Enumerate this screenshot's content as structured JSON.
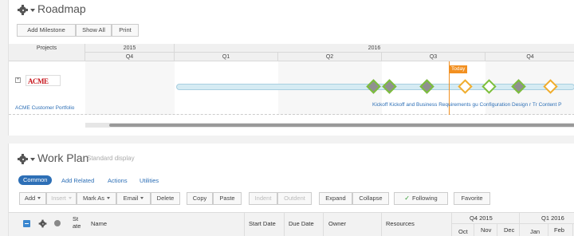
{
  "roadmap": {
    "title": "Roadmap",
    "buttons": {
      "add_milestone": "Add Milestone",
      "show_all": "Show All",
      "print": "Print"
    },
    "projects_header": "Projects",
    "years": [
      "2015",
      "2016"
    ],
    "quarters": [
      "Q4",
      "Q1",
      "Q2",
      "Q3",
      "Q4"
    ],
    "project_name": "ACME Customer Portfolio",
    "logo_text": "ACME",
    "expand_symbol": "+",
    "today_label": "Today",
    "milestone_labels": "Kickoff Kickoff and Business Requirements gu Configuration Design r Tr Content P",
    "colors": {
      "today": "#f29021",
      "done_border": "#7cbf3c",
      "open_orange": "#f0ad2e",
      "link": "#2d6fb6"
    }
  },
  "workplan": {
    "title": "Work Plan",
    "subtitle": "Standard display",
    "tabs": [
      "Common",
      "Add Related",
      "Actions",
      "Utilities"
    ],
    "toolbar": {
      "add": "Add",
      "insert": "Insert",
      "mark_as": "Mark As",
      "email": "Email",
      "delete": "Delete",
      "copy": "Copy",
      "paste": "Paste",
      "indent": "Indent",
      "outdent": "Outdent",
      "expand": "Expand",
      "collapse": "Collapse",
      "following": "Following",
      "favorite": "Favorite"
    },
    "columns": {
      "state_line1": "St",
      "state_line2": "ate",
      "name": "Name",
      "start_date": "Start Date",
      "due_date": "Due Date",
      "owner": "Owner",
      "resources": "Resources"
    },
    "timeline_quarters": [
      "Q4 2015",
      "Q1 2016"
    ],
    "timeline_months": [
      "Oct",
      "Nov",
      "Dec",
      "Jan",
      "Feb"
    ]
  }
}
